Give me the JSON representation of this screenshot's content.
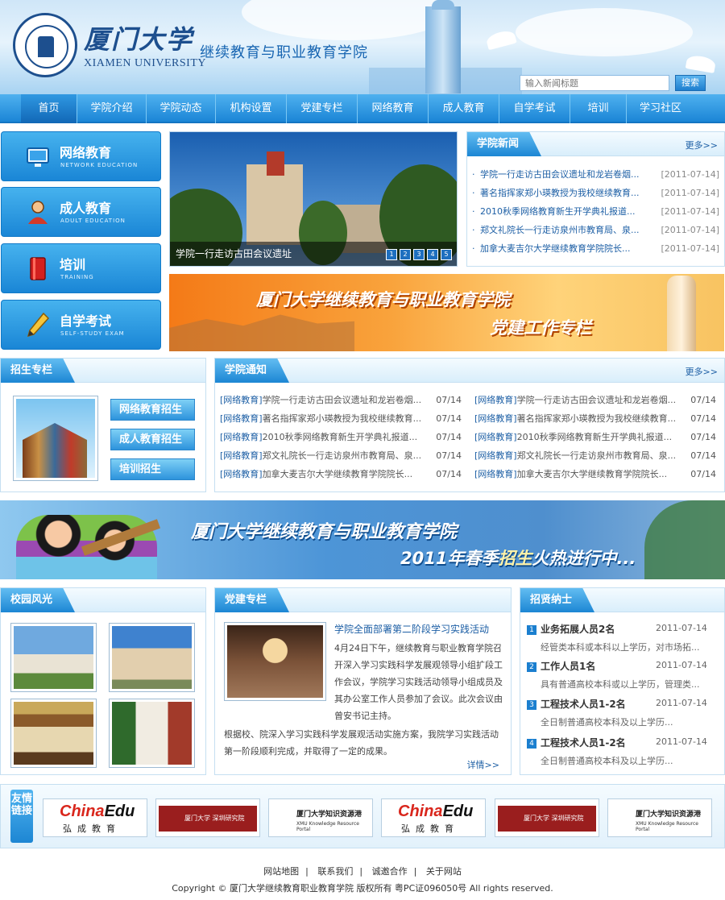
{
  "header": {
    "logo_cn": "厦门大学",
    "logo_en": "XIAMEN UNIVERSITY",
    "site_name": "继续教育与职业教育学院",
    "search_placeholder": "输入新闻标题",
    "search_button": "搜索"
  },
  "nav": [
    "首页",
    "学院介绍",
    "学院动态",
    "机构设置",
    "党建专栏",
    "网络教育",
    "成人教育",
    "自学考试",
    "培训",
    "学习社区"
  ],
  "left_boxes": [
    {
      "cn": "网络教育",
      "en": "NETWORK EDUCATION",
      "icon": "monitor-icon"
    },
    {
      "cn": "成人教育",
      "en": "ADULT EDUCATION",
      "icon": "person-icon"
    },
    {
      "cn": "培训",
      "en": "TRAINING",
      "icon": "book-icon"
    },
    {
      "cn": "自学考试",
      "en": "SELF-STUDY EXAM",
      "icon": "pencil-icon"
    }
  ],
  "slideshow": {
    "caption": "学院一行走访古田会议遗址",
    "pages": [
      "1",
      "2",
      "3",
      "4",
      "5"
    ]
  },
  "college_news": {
    "title": "学院新闻",
    "more": "更多>>",
    "items": [
      {
        "title": "学院一行走访古田会议遗址和龙岩卷烟...",
        "date": "[2011-07-14]"
      },
      {
        "title": "著名指挥家郑小瑛教授为我校继续教育...",
        "date": "[2011-07-14]"
      },
      {
        "title": "2010秋季网络教育新生开学典礼报道...",
        "date": "[2011-07-14]"
      },
      {
        "title": "郑文礼院长一行走访泉州市教育局、泉...",
        "date": "[2011-07-14]"
      },
      {
        "title": "加拿大麦吉尔大学继续教育学院院长...",
        "date": "[2011-07-14]"
      }
    ]
  },
  "party_banner": {
    "line1": "厦门大学继续教育与职业教育学院",
    "line2": "党建工作专栏"
  },
  "admissions": {
    "title": "招生专栏",
    "buttons": [
      "网络教育招生",
      "成人教育招生",
      "培训招生"
    ]
  },
  "notices": {
    "title": "学院通知",
    "more": "更多>>",
    "category": "[网络教育]",
    "items": [
      {
        "title": "学院一行走访古田会议遗址和龙岩卷烟...",
        "date": "07/14"
      },
      {
        "title": "著名指挥家郑小瑛教授为我校继续教育...",
        "date": "07/14"
      },
      {
        "title": "2010秋季网络教育新生开学典礼报道...",
        "date": "07/14"
      },
      {
        "title": "郑文礼院长一行走访泉州市教育局、泉...",
        "date": "07/14"
      },
      {
        "title": "加拿大麦吉尔大学继续教育学院院长...",
        "date": "07/14"
      }
    ]
  },
  "recruit_banner": {
    "line1": "厦门大学继续教育与职业教育学院",
    "line2_a": "2011年春季",
    "line2_b": "招生",
    "line2_c": "火热进行中..."
  },
  "campus": {
    "title": "校园风光"
  },
  "party_column": {
    "title": "党建专栏",
    "headline": "学院全面部署第二阶段学习实践活动",
    "para1": "4月24日下午，继续教育与职业教育学院召开深入学习实践科学发展观领导小组扩段工作会议，学院学习实践活动领导小组成员及其办公室工作人员参加了会议。此次会议由曾安书记主持。",
    "para2": "根据校、院深入学习实践科学发展观活动实施方案，我院学习实践活动第一阶段顺利完成，并取得了一定的成果。",
    "more": "详情>>"
  },
  "jobs": {
    "title": "招贤纳士",
    "items": [
      {
        "num": "1",
        "title": "业务拓展人员2名",
        "date": "2011-07-14",
        "desc": "经管类本科或本科以上学历，对市场拓..."
      },
      {
        "num": "2",
        "title": "工作人员1名",
        "date": "2011-07-14",
        "desc": "具有普通高校本科或以上学历，管理类..."
      },
      {
        "num": "3",
        "title": "工程技术人员1-2名",
        "date": "2011-07-14",
        "desc": "全日制普通高校本科及以上学历..."
      },
      {
        "num": "4",
        "title": "工程技术人员1-2名",
        "date": "2011-07-14",
        "desc": "全日制普通高校本科及以上学历..."
      }
    ]
  },
  "links": {
    "tag": "友情链接",
    "chinaedu_a": "China",
    "chinaedu_b": "Edu",
    "chinaedu_cn": "弘成教育",
    "xmu_sz": "厦门大学 深圳研究院",
    "xmu_krp_cn": "厦门大学知识资源港",
    "xmu_krp_en": "XMU Knowledge Resource Portal"
  },
  "footer": {
    "links": [
      "网站地图",
      "联系我们",
      "诚邀合作",
      "关于网站"
    ],
    "copyright": "Copyright © 厦门大学继续教育职业教育学院 版权所有 粤PC证096050号    All rights reserved."
  },
  "colors": {
    "primary": "#1b85d6",
    "link": "#1d5fa5",
    "banner_orange": "#f47a17"
  }
}
